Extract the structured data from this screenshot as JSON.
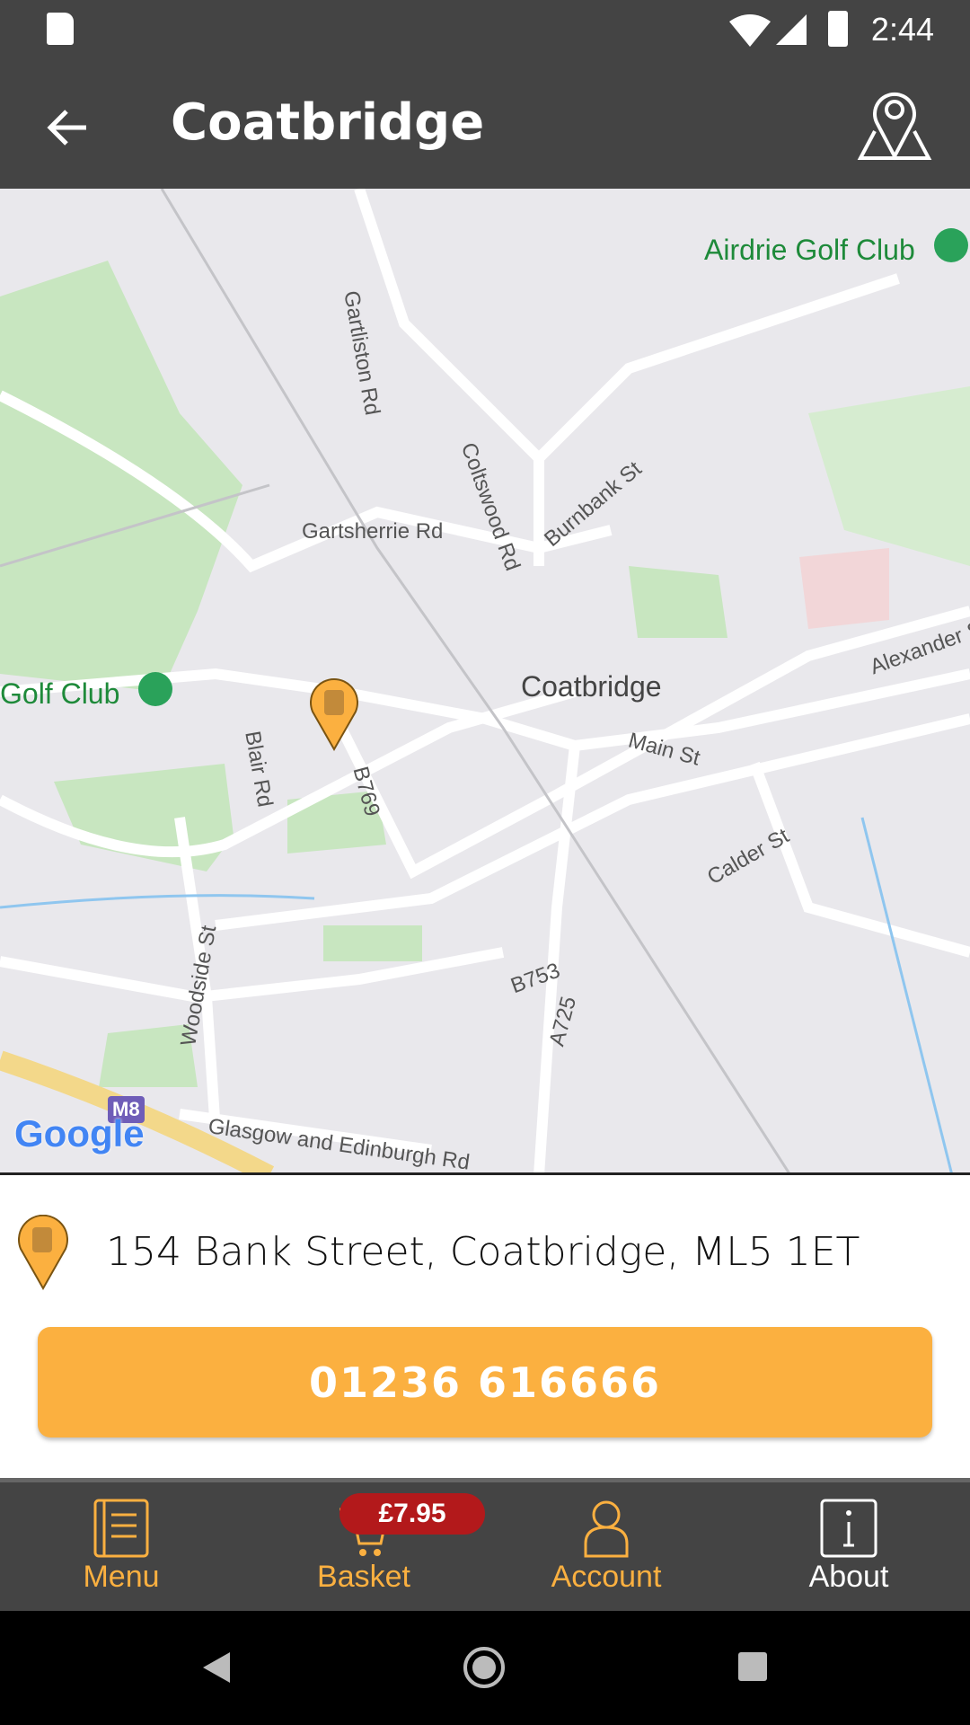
{
  "status_bar": {
    "time": "2:44"
  },
  "app_bar": {
    "title": "Coatbridge"
  },
  "map": {
    "labels": {
      "airdrie_golf": "Airdrie Golf Club",
      "golf_club": "Golf Club",
      "coatbridge": "Coatbridge",
      "gartliston": "Gartliston Rd",
      "coltswood": "Coltswood Rd",
      "burnbank": "Burnbank St",
      "gartsherrie": "Gartsherrie Rd",
      "alexander": "Alexander St",
      "main": "Main St",
      "blair": "Blair Rd",
      "b769": "B769",
      "calder": "Calder St",
      "b753": "B753",
      "woodside": "Woodside St",
      "a725": "A725",
      "glasgow": "Glasgow and Edinburgh Rd",
      "m8": "M8",
      "google": "Google"
    }
  },
  "location": {
    "address": "154 Bank Street, Coatbridge, ML5 1ET",
    "phone": "01236 616666"
  },
  "bottom_nav": {
    "items": [
      {
        "label": "Menu"
      },
      {
        "label": "Basket",
        "badge": "£7.95"
      },
      {
        "label": "Account"
      },
      {
        "label": "About"
      }
    ]
  },
  "colors": {
    "accent": "#fbb040",
    "bar": "#444444",
    "badge": "#b3191b"
  }
}
